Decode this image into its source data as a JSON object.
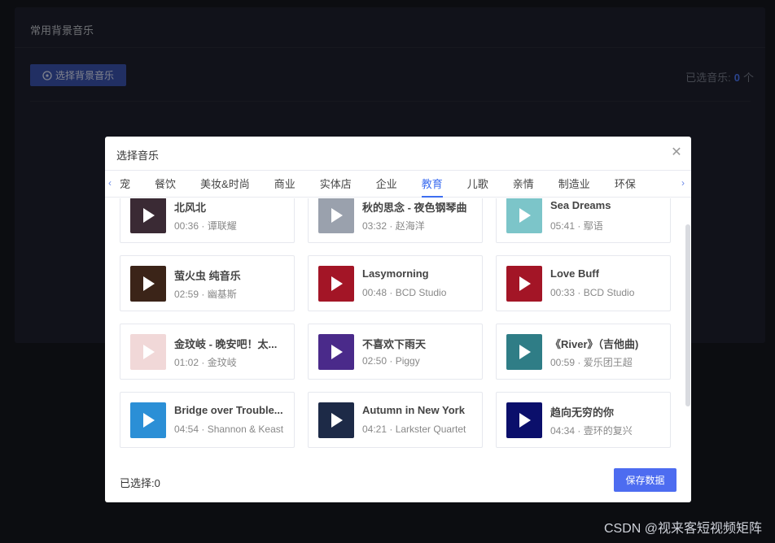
{
  "background": {
    "section_title": "常用背景音乐",
    "select_button_label": "选择背景音乐",
    "selected_count_prefix": "已选音乐:",
    "selected_count_value": "0",
    "selected_count_suffix": "个"
  },
  "modal": {
    "title": "选择音乐",
    "close_icon": "close-icon",
    "tabs": [
      {
        "label": "宠"
      },
      {
        "label": "餐饮"
      },
      {
        "label": "美妆&时尚"
      },
      {
        "label": "商业"
      },
      {
        "label": "实体店"
      },
      {
        "label": "企业"
      },
      {
        "label": "教育",
        "active": true
      },
      {
        "label": "儿歌"
      },
      {
        "label": "亲情"
      },
      {
        "label": "制造业"
      },
      {
        "label": "环保"
      }
    ],
    "cards": [
      {
        "title": "北风北",
        "meta": "00:36 · 谭联耀",
        "color": "#3a2a34"
      },
      {
        "title": "秋的思念 - 夜色钢琴曲",
        "meta": "03:32 · 赵海洋",
        "color": "#9aa1ad"
      },
      {
        "title": "Sea Dreams",
        "meta": "05:41 · 鄢语",
        "color": "#7cc5c9"
      },
      {
        "title": "萤火虫 纯音乐",
        "meta": "02:59 · 幽基斯",
        "color": "#3b2418"
      },
      {
        "title": "Lasymorning",
        "meta": "00:48 · BCD Studio",
        "color": "#a31526"
      },
      {
        "title": "Love Buff",
        "meta": "00:33 · BCD Studio",
        "color": "#a31526"
      },
      {
        "title": "金玟岐 - 晚安吧！太...",
        "meta": "01:02 · 金玟岐",
        "color": "#f1d8d8"
      },
      {
        "title": "不喜欢下雨天",
        "meta": "02:50 · Piggy",
        "color": "#4a2a8a"
      },
      {
        "title": "《River》（吉他曲)",
        "meta": "00:59 · 爱乐团王超",
        "color": "#2f7d86"
      },
      {
        "title": "Bridge over Trouble...",
        "meta": "04:54 · Shannon & Keast",
        "color": "#2b8fd6"
      },
      {
        "title": "Autumn in New York",
        "meta": "04:21 · Larkster Quartet",
        "color": "#1d2a47"
      },
      {
        "title": "趋向无穷的你",
        "meta": "04:34 · 壹环的复兴",
        "color": "#0b0f6b"
      }
    ],
    "selected_label": "已选择:",
    "selected_value": "0",
    "save_button_label": "保存数据"
  },
  "watermark": "CSDN @视来客短视频矩阵",
  "colors": {
    "accent": "#3d6ef0",
    "save_button": "#4d6cf0",
    "select_button": "#3d57b5"
  }
}
